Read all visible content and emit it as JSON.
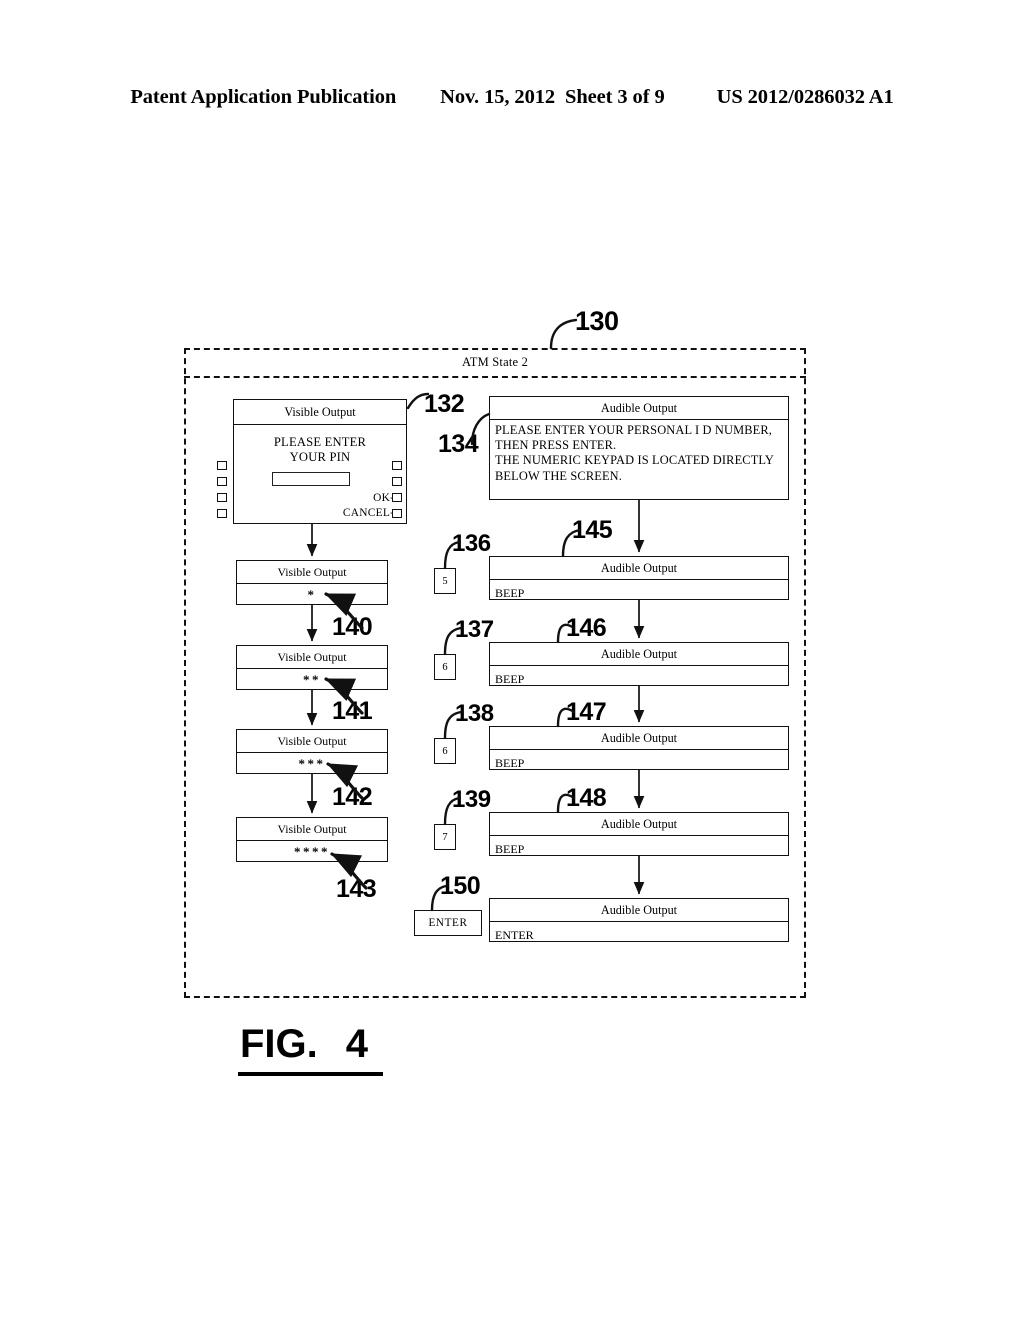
{
  "header": {
    "publication": "Patent Application Publication",
    "date": "Nov. 15, 2012",
    "sheet": "Sheet 3 of 9",
    "docnum": "US 2012/0286032 A1"
  },
  "figure": {
    "label": "FIG.",
    "number": "4"
  },
  "state_container": {
    "ref": "130",
    "title": "ATM State 2"
  },
  "atm_screen": {
    "ref": "132",
    "header": "Visible Output",
    "message_line1": "PLEASE ENTER",
    "message_line2": "YOUR PIN",
    "ok_label": "OK->",
    "cancel_label": "CANCEL->",
    "left_buttons": 4,
    "right_buttons": 4
  },
  "audible_prompt": {
    "ref": "134",
    "header": "Audible Output",
    "line1": "PLEASE ENTER YOUR PERSONAL I D NUMBER,",
    "line2": "THEN PRESS ENTER.",
    "line3": "THE NUMERIC KEYPAD IS LOCATED DIRECTLY",
    "line4": "BELOW THE SCREEN."
  },
  "visible_outputs": [
    {
      "ref": "140",
      "header": "Visible Output",
      "value": "*"
    },
    {
      "ref": "141",
      "header": "Visible Output",
      "value": "**"
    },
    {
      "ref": "142",
      "header": "Visible Output",
      "value": "***"
    },
    {
      "ref": "143",
      "header": "Visible Output",
      "value": "****"
    }
  ],
  "keypresses": [
    {
      "ref": "136",
      "key": "5"
    },
    {
      "ref": "137",
      "key": "6"
    },
    {
      "ref": "138",
      "key": "6"
    },
    {
      "ref": "139",
      "key": "7"
    },
    {
      "ref": "150",
      "key": "ENTER"
    }
  ],
  "audible_responses": [
    {
      "ref": "145",
      "header": "Audible Output",
      "value": "BEEP"
    },
    {
      "ref": "146",
      "header": "Audible Output",
      "value": "BEEP"
    },
    {
      "ref": "147",
      "header": "Audible Output",
      "value": "BEEP"
    },
    {
      "ref": "148",
      "header": "Audible Output",
      "value": "BEEP"
    },
    {
      "ref": "150",
      "header": "Audible Output",
      "value": "ENTER"
    }
  ]
}
